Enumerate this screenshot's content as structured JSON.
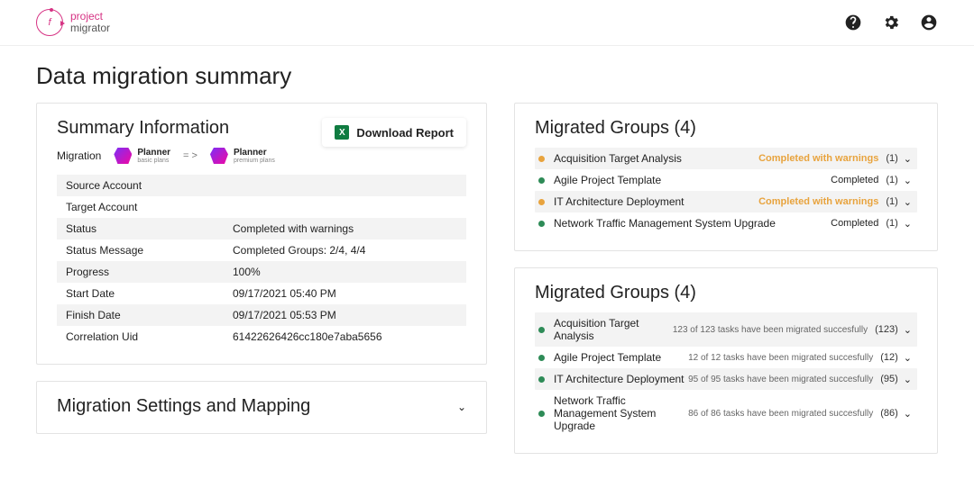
{
  "brand": {
    "line1": "project",
    "line2": "migrator"
  },
  "page_title": "Data migration summary",
  "summary_panel": {
    "title": "Summary Information",
    "migration_label": "Migration",
    "planner_from": {
      "title": "Planner",
      "sub": "basic plans"
    },
    "arrow": "= >",
    "planner_to": {
      "title": "Planner",
      "sub": "premium plans"
    },
    "download_label": "Download Report",
    "rows": [
      {
        "k": "Source Account",
        "v": ""
      },
      {
        "k": "Target Account",
        "v": ""
      },
      {
        "k": "Status",
        "v": "Completed with warnings"
      },
      {
        "k": "Status Message",
        "v": "Completed Groups: 2/4, 4/4"
      },
      {
        "k": "Progress",
        "v": "100%"
      },
      {
        "k": "Start Date",
        "v": "09/17/2021 05:40 PM"
      },
      {
        "k": "Finish Date",
        "v": "09/17/2021 05:53 PM"
      },
      {
        "k": "Correlation Uid",
        "v": "61422626426cc180e7aba5656"
      }
    ]
  },
  "settings_panel": {
    "title": "Migration Settings and Mapping"
  },
  "groups_panel_1": {
    "title": "Migrated Groups (4)",
    "items": [
      {
        "name": "Acquisition Target Analysis",
        "status": "Completed with warnings",
        "style": "warn",
        "count": "(1)",
        "dot": "orange"
      },
      {
        "name": "Agile Project Template",
        "status": "Completed",
        "style": "ok",
        "count": "(1)",
        "dot": "green"
      },
      {
        "name": "IT Architecture Deployment",
        "status": "Completed with warnings",
        "style": "warn",
        "count": "(1)",
        "dot": "orange"
      },
      {
        "name": "Network Traffic Management System Upgrade",
        "status": "Completed",
        "style": "ok",
        "count": "(1)",
        "dot": "green"
      }
    ]
  },
  "groups_panel_2": {
    "title": "Migrated Groups (4)",
    "items": [
      {
        "name": "Acquisition Target Analysis",
        "status": "123 of 123 tasks have been migrated succesfully",
        "style": "msg",
        "count": "(123)",
        "dot": "green"
      },
      {
        "name": "Agile Project Template",
        "status": "12 of 12 tasks have been migrated succesfully",
        "style": "msg",
        "count": "(12)",
        "dot": "green"
      },
      {
        "name": "IT Architecture Deployment",
        "status": "95 of 95 tasks have been migrated succesfully",
        "style": "msg",
        "count": "(95)",
        "dot": "green"
      },
      {
        "name": "Network Traffic Management System Upgrade",
        "status": "86 of 86 tasks have been migrated succesfully",
        "style": "msg",
        "count": "(86)",
        "dot": "green"
      }
    ]
  }
}
